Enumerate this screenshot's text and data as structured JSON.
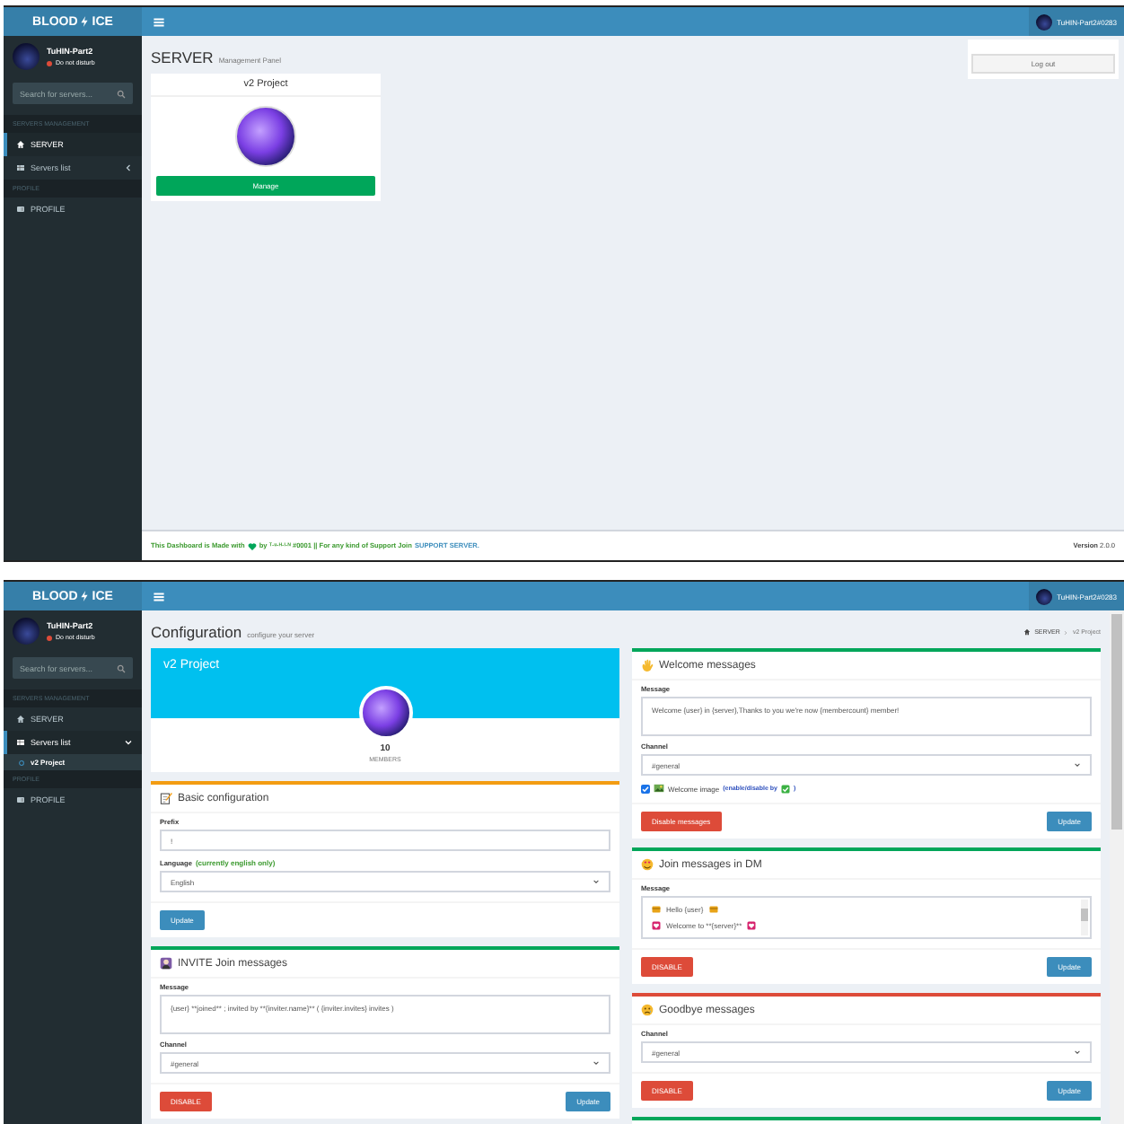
{
  "screens": [
    {
      "kind": "servers",
      "brand": {
        "left": "BLOOD",
        "right": "ICE"
      },
      "account": "TuHIN-Part2#0283",
      "user": {
        "name": "TuHIN-Part2",
        "status": "Do not disturb"
      },
      "search": {
        "placeholder": "Search for servers..."
      },
      "nav": [
        {
          "kind": "header",
          "label": "SERVERS MANAGEMENT"
        },
        {
          "kind": "link",
          "label": "SERVER",
          "selected": true
        },
        {
          "kind": "link",
          "label": "Servers list",
          "selected": false,
          "expanded": false
        },
        {
          "kind": "header",
          "label": "PROFILE"
        },
        {
          "kind": "link",
          "label": "PROFILE",
          "selected": false
        }
      ],
      "content": {
        "title": "SERVER",
        "subtitle": "Management Panel",
        "logout": "Log out",
        "servers": [
          {
            "name": "v2 Project",
            "action": "Manage"
          }
        ],
        "footer": {
          "before": "This Dashboard is Made with",
          "after": "by ᵀ·ᵘ·ᴴ·ᴵ·ᴺ #0001 || For any kind of Support Join",
          "link": "SUPPORT SERVER.",
          "version": "**Version** 2.0.0"
        }
      }
    },
    {
      "kind": "config",
      "brand": {
        "left": "BLOOD",
        "right": "ICE"
      },
      "account": "TuHIN-Part2#0283",
      "user": {
        "name": "TuHIN-Part2",
        "status": "Do not disturb"
      },
      "search": {
        "placeholder": "Search for servers..."
      },
      "nav": [
        {
          "kind": "header",
          "label": "SERVERS MANAGEMENT"
        },
        {
          "kind": "link",
          "label": "SERVER",
          "selected": false
        },
        {
          "kind": "link",
          "label": "Servers list",
          "selected": true,
          "expanded": true,
          "children": [
            {
              "label": "v2 Project",
              "selected": true
            }
          ]
        },
        {
          "kind": "header",
          "label": "PROFILE"
        },
        {
          "kind": "link",
          "label": "PROFILE",
          "selected": false
        }
      ],
      "content": {
        "title": "Configuration",
        "subtitle": "configure your server",
        "breadcrumb": [
          "SERVER",
          "v2 Project"
        ],
        "server": {
          "name": "v2 Project",
          "count": "10",
          "count_label": "MEMBERS"
        },
        "columns": [
          [
            {
              "title": "Basic configuration",
              "color": "#f39c12",
              "fields": [
                {
                  "kind": "input",
                  "label": "Prefix",
                  "value": "!"
                },
                {
                  "kind": "select",
                  "label": "Language",
                  "note": "(currently english only)",
                  "value": "English"
                }
              ],
              "buttons": [
                {
                  "kind": "primary",
                  "label": "Update"
                }
              ]
            },
            {
              "title": "INVITE Join messages",
              "color": "#00a65a",
              "fields": [
                {
                  "kind": "textarea",
                  "label": "Message",
                  "value": "{user} **joined** ; invited by **{inviter.name}** ( {inviter.invites} invites )"
                },
                {
                  "kind": "select",
                  "label": "Channel",
                  "value": "#general"
                }
              ],
              "buttons": [
                {
                  "kind": "danger",
                  "label": "DISABLE"
                },
                {
                  "kind": "primary",
                  "label": "Update"
                }
              ]
            }
          ],
          [
            {
              "title": "Welcome messages",
              "color": "#00a65a",
              "fields": [
                {
                  "kind": "textarea",
                  "label": "Message",
                  "value": "Welcome {user} in {server},Thanks to you we're now {membercount} member!"
                },
                {
                  "kind": "select",
                  "label": "Channel",
                  "value": "#general"
                },
                {
                  "kind": "checkbox",
                  "checked": true,
                  "label": "Welcome image",
                  "hint": "(enable/disable by",
                  "hint_end": ")"
                }
              ],
              "buttons": [
                {
                  "kind": "danger",
                  "label": "Disable messages"
                },
                {
                  "kind": "primary",
                  "label": "Update"
                }
              ]
            },
            {
              "title": "Join messages in DM",
              "color": "#00a65a",
              "fields": [
                {
                  "kind": "lines",
                  "label": "Message",
                  "lines": [
                    "Hello {user}",
                    "Welcome to **{server}**"
                  ]
                }
              ],
              "buttons": [
                {
                  "kind": "danger",
                  "label": "DISABLE"
                },
                {
                  "kind": "primary",
                  "label": "Update"
                }
              ]
            },
            {
              "title": "Goodbye messages",
              "color": "#dd4b39",
              "fields": [
                {
                  "kind": "select",
                  "label": "Channel",
                  "value": "#general"
                }
              ],
              "buttons": [
                {
                  "kind": "danger",
                  "label": "DISABLE"
                },
                {
                  "kind": "primary",
                  "label": "Update"
                }
              ]
            },
            {
              "color": "#00a65a"
            }
          ]
        ]
      }
    }
  ]
}
